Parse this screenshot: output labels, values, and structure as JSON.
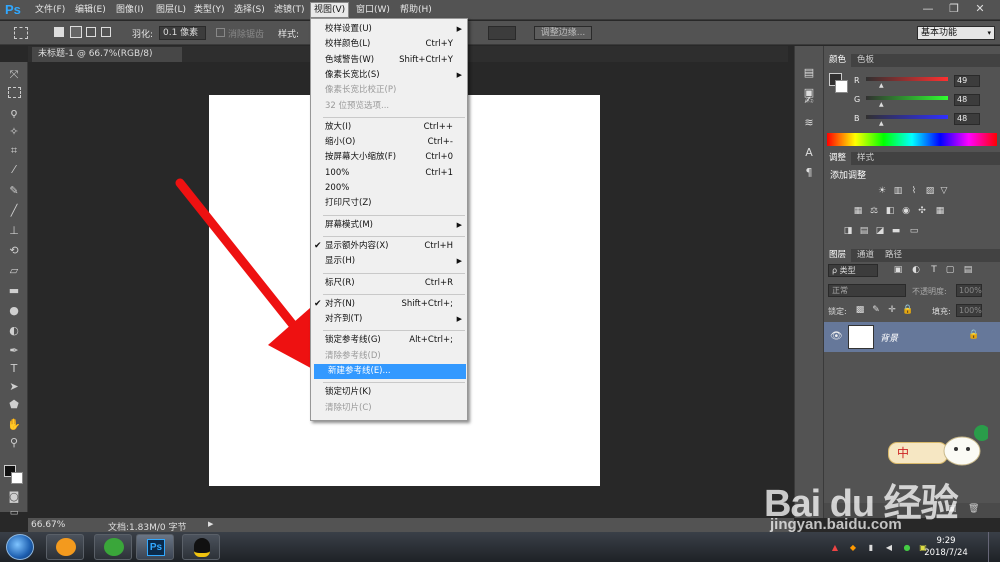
{
  "app": {
    "logo": "Ps"
  },
  "menubar": {
    "items": [
      "文件(F)",
      "编辑(E)",
      "图像(I)",
      "图层(L)",
      "类型(Y)",
      "选择(S)",
      "滤镜(T)",
      "视图(V)",
      "窗口(W)",
      "帮助(H)"
    ],
    "active_index": 7,
    "window_buttons": [
      "—",
      "❐",
      "✕"
    ]
  },
  "optionsbar": {
    "feather_label": "羽化:",
    "feather_value": "0.1 像素",
    "antialias_label": "消除锯齿",
    "style_label": "样式:",
    "refine_edge_label": "调整边缘...",
    "workspace_value": "基本功能"
  },
  "document": {
    "tab_title": "未标题-1 @ 66.7%(RGB/8)"
  },
  "statusbar": {
    "zoom": "66.67%",
    "doc_info": "文档:1.83M/0 字节"
  },
  "view_menu": {
    "items": [
      {
        "label": "校样设置(U)",
        "shortcut": "",
        "submenu": true,
        "disabled": false,
        "checked": false
      },
      {
        "label": "校样颜色(L)",
        "shortcut": "Ctrl+Y",
        "submenu": false,
        "disabled": false,
        "checked": false
      },
      {
        "label": "色域警告(W)",
        "shortcut": "Shift+Ctrl+Y",
        "submenu": false,
        "disabled": false,
        "checked": false
      },
      {
        "label": "像素长宽比(S)",
        "shortcut": "",
        "submenu": true,
        "disabled": false,
        "checked": false
      },
      {
        "label": "像素长宽比校正(P)",
        "shortcut": "",
        "submenu": false,
        "disabled": true,
        "checked": false
      },
      {
        "label": "32 位预览选项...",
        "shortcut": "",
        "submenu": false,
        "disabled": true,
        "checked": false
      },
      {
        "sep": true
      },
      {
        "label": "放大(I)",
        "shortcut": "Ctrl++",
        "submenu": false,
        "disabled": false,
        "checked": false
      },
      {
        "label": "缩小(O)",
        "shortcut": "Ctrl+-",
        "submenu": false,
        "disabled": false,
        "checked": false
      },
      {
        "label": "按屏幕大小缩放(F)",
        "shortcut": "Ctrl+0",
        "submenu": false,
        "disabled": false,
        "checked": false
      },
      {
        "label": "100%",
        "shortcut": "Ctrl+1",
        "submenu": false,
        "disabled": false,
        "checked": false
      },
      {
        "label": "200%",
        "shortcut": "",
        "submenu": false,
        "disabled": false,
        "checked": false
      },
      {
        "label": "打印尺寸(Z)",
        "shortcut": "",
        "submenu": false,
        "disabled": false,
        "checked": false
      },
      {
        "sep": true
      },
      {
        "label": "屏幕模式(M)",
        "shortcut": "",
        "submenu": true,
        "disabled": false,
        "checked": false
      },
      {
        "sep": true
      },
      {
        "label": "显示额外内容(X)",
        "shortcut": "Ctrl+H",
        "submenu": false,
        "disabled": false,
        "checked": true
      },
      {
        "label": "显示(H)",
        "shortcut": "",
        "submenu": true,
        "disabled": false,
        "checked": false
      },
      {
        "sep": true
      },
      {
        "label": "标尺(R)",
        "shortcut": "Ctrl+R",
        "submenu": false,
        "disabled": false,
        "checked": false
      },
      {
        "sep": true
      },
      {
        "label": "对齐(N)",
        "shortcut": "Shift+Ctrl+;",
        "submenu": false,
        "disabled": false,
        "checked": true
      },
      {
        "label": "对齐到(T)",
        "shortcut": "",
        "submenu": true,
        "disabled": false,
        "checked": false
      },
      {
        "sep": true
      },
      {
        "label": "锁定参考线(G)",
        "shortcut": "Alt+Ctrl+;",
        "submenu": false,
        "disabled": false,
        "checked": false
      },
      {
        "label": "清除参考线(D)",
        "shortcut": "",
        "submenu": false,
        "disabled": true,
        "checked": false
      },
      {
        "label": "新建参考线(E)...",
        "shortcut": "",
        "submenu": false,
        "disabled": false,
        "checked": false,
        "highlighted": true
      },
      {
        "sep": true
      },
      {
        "label": "锁定切片(K)",
        "shortcut": "",
        "submenu": false,
        "disabled": false,
        "checked": false
      },
      {
        "label": "清除切片(C)",
        "shortcut": "",
        "submenu": false,
        "disabled": true,
        "checked": false
      }
    ]
  },
  "color_panel": {
    "tabs": [
      "颜色",
      "色板"
    ],
    "channels": [
      {
        "name": "R",
        "value": "49",
        "color": "#e03030"
      },
      {
        "name": "G",
        "value": "48",
        "color": "#30c040"
      },
      {
        "name": "B",
        "value": "48",
        "color": "#3040e0"
      }
    ]
  },
  "adjustments_panel": {
    "tabs": [
      "调整",
      "样式"
    ],
    "title": "添加调整"
  },
  "layers_panel": {
    "tabs": [
      "图层",
      "通道",
      "路径"
    ],
    "filter_label": "ρ 类型",
    "blend_mode": "正常",
    "opacity_label": "不透明度:",
    "opacity_value": "100%",
    "lock_label": "锁定:",
    "fill_label": "填充:",
    "fill_value": "100%",
    "layer_name": "背景"
  },
  "taskbar": {
    "time": "9:29",
    "date": "2018/7/24",
    "ime_label": "中"
  },
  "watermark": {
    "brand": "Bai du 经验",
    "url": "jingyan.baidu.com"
  },
  "colors": {
    "accent": "#3399ff",
    "ps_blue": "#31a8ff",
    "arrow": "#ee1111"
  }
}
